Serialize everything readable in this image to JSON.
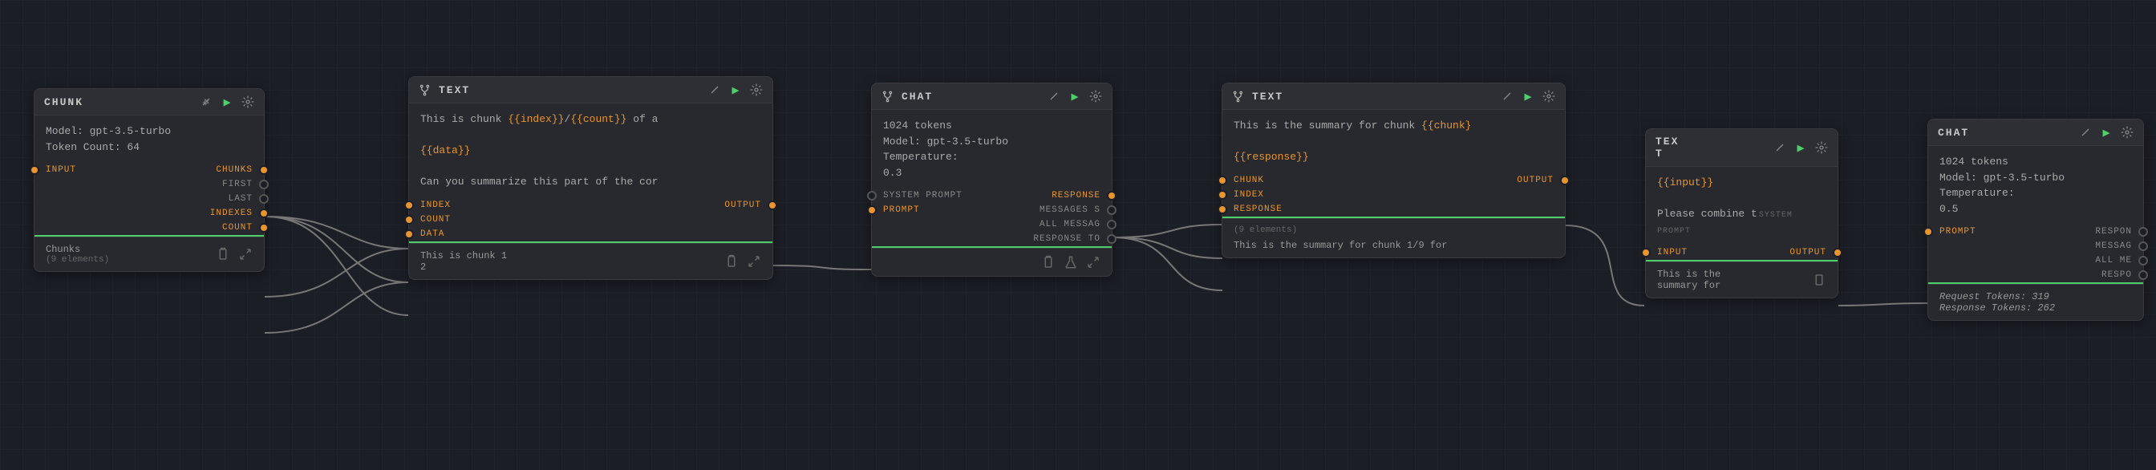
{
  "nodes": {
    "chunk": {
      "title": "CHUNK",
      "body_line1": "Model: gpt-3.5-turbo",
      "body_line2": "Token Count: 64",
      "ports": {
        "input": "INPUT",
        "chunks": "CHUNKS",
        "first": "FIRST",
        "last": "LAST",
        "indexes": "INDEXES",
        "count": "COUNT"
      },
      "foot_title": "Chunks",
      "foot_sub": "(9 elements)"
    },
    "text1": {
      "title": "TEXT",
      "body_pre": "This is chunk ",
      "body_var1": "{{index}}",
      "body_slash": "/",
      "body_var2": "{{count}}",
      "body_post": " of a",
      "body_l2": "{{data}}",
      "body_l3": "Can you summarize this part of the cor",
      "ports": {
        "index": "INDEX",
        "count": "COUNT",
        "data": "DATA",
        "output": "OUTPUT"
      },
      "foot_l1": "This is chunk 1",
      "foot_l2": "2"
    },
    "chat1": {
      "title": "CHAT",
      "body_l1": "1024 tokens",
      "body_l2": "Model: gpt-3.5-turbo",
      "body_l3": "Temperature:",
      "body_l4": "0.3",
      "ports": {
        "sys": "SYSTEM PROMPT",
        "prompt": "PROMPT",
        "response": "RESPONSE",
        "msgs": "MESSAGES S",
        "allmsg": "ALL MESSAG",
        "respto": "RESPONSE TO"
      }
    },
    "text2": {
      "title": "TEXT",
      "body_pre": "This is the summary for chunk ",
      "body_var": "{{chunk}",
      "body_l2": "{{response}}",
      "ports": {
        "chunk": "CHUNK",
        "index": "INDEX",
        "response": "RESPONSE",
        "output": "OUTPUT"
      },
      "foot_sub": "(9 elements)",
      "foot_txt": "This is the summary for chunk 1/9 for"
    },
    "text3": {
      "title": "TEX",
      "title2": "T",
      "body_l1": "{{input}}",
      "body_l2": "Please combine t",
      "ports": {
        "sys": "SYSTEM PROMPT",
        "input": "INPUT",
        "output": "OUTPUT"
      },
      "foot_l1": "This is the",
      "foot_l2": "summary for"
    },
    "chat2": {
      "title": "CHAT",
      "body_l1": "1024 tokens",
      "body_l2": "Model: gpt-3.5-turbo",
      "body_l3": "Temperature:",
      "body_l4": "0.5",
      "ports": {
        "prompt": "PROMPT",
        "respon": "RESPON",
        "messag": "MESSAG",
        "allm": "ALL ME",
        "respo": "RESPO"
      },
      "foot_l1": "Request Tokens: 319",
      "foot_l2": "Response Tokens: 262"
    }
  }
}
